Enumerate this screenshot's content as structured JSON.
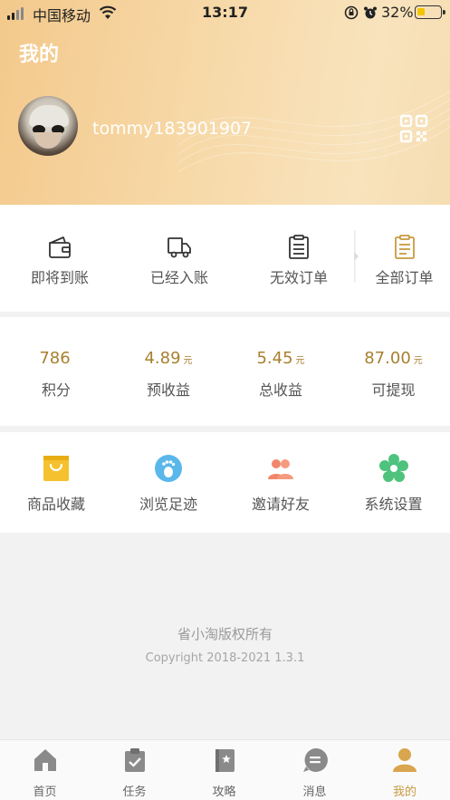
{
  "status_bar": {
    "carrier": "中国移动",
    "time": "13:17",
    "battery_percent": "32%",
    "battery_level": 0.32
  },
  "header": {
    "title": "我的",
    "username": "tommy183901907",
    "qr_icon": "qr-code-icon"
  },
  "orders": [
    {
      "label": "即将到账",
      "icon": "wallet-icon"
    },
    {
      "label": "已经入账",
      "icon": "truck-icon"
    },
    {
      "label": "无效订单",
      "icon": "clipboard-icon"
    },
    {
      "label": "全部订单",
      "icon": "clipboard-list-icon"
    }
  ],
  "stats": [
    {
      "value": "786",
      "unit": "",
      "label": "积分"
    },
    {
      "value": "4.89",
      "unit": "元",
      "label": "预收益"
    },
    {
      "value": "5.45",
      "unit": "元",
      "label": "总收益"
    },
    {
      "value": "87.00",
      "unit": "元",
      "label": "可提现"
    }
  ],
  "tools": [
    {
      "label": "商品收藏",
      "icon": "shopping-bag-icon",
      "color": "#f5c12e"
    },
    {
      "label": "浏览足迹",
      "icon": "footprint-icon",
      "color": "#5ab7ea"
    },
    {
      "label": "邀请好友",
      "icon": "people-icon",
      "color": "#f2866a"
    },
    {
      "label": "系统设置",
      "icon": "flower-gear-icon",
      "color": "#4fc37e"
    }
  ],
  "footer": {
    "copyright": "省小淘版权所有",
    "version": "Copyright 2018-2021 1.3.1"
  },
  "tabbar": [
    {
      "label": "首页",
      "icon": "home-icon",
      "active": false
    },
    {
      "label": "任务",
      "icon": "task-icon",
      "active": false
    },
    {
      "label": "攻略",
      "icon": "guide-book-icon",
      "active": false
    },
    {
      "label": "消息",
      "icon": "message-icon",
      "active": false
    },
    {
      "label": "我的",
      "icon": "user-icon",
      "active": true
    }
  ],
  "colors": {
    "accent": "#c89a42",
    "stat_value": "#a8802e",
    "header_gradient_start": "#f3c98c",
    "header_gradient_end": "#f8e3bd"
  }
}
